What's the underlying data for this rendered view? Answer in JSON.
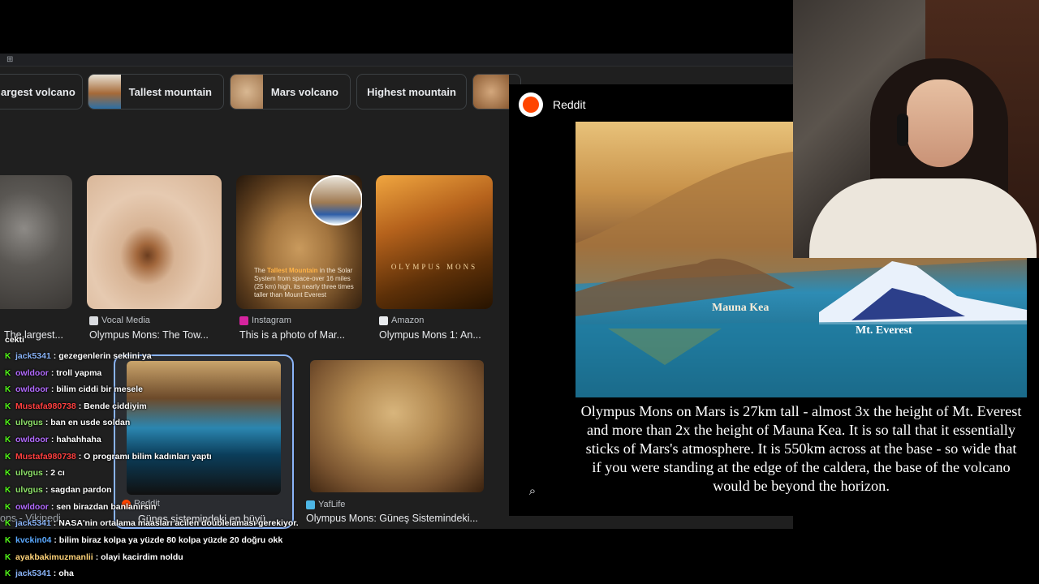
{
  "browser": {
    "apps_icon": "apps-grid-icon"
  },
  "chips": [
    {
      "label": "argest volcano",
      "thumb": false
    },
    {
      "label": "Tallest mountain",
      "thumb": true
    },
    {
      "label": "Mars volcano",
      "thumb": true
    },
    {
      "label": "Highest mountain",
      "thumb": false
    },
    {
      "label": "",
      "thumb": true
    }
  ],
  "results": [
    {
      "source": "",
      "title": "The largest..."
    },
    {
      "source": "Vocal Media",
      "title": "Olympus Mons: The Tow..."
    },
    {
      "source": "Instagram",
      "title": "This is a photo of Mar..."
    },
    {
      "source": "Amazon",
      "title": "Olympus Mons 1: An..."
    },
    {
      "source": "Reddit",
      "title": "Güneş sistemindeki en büyü..."
    },
    {
      "source": "YafLife",
      "title": "Olympus Mons: Güneş Sistemindeki..."
    },
    {
      "source": "",
      "title": "ons - Vikipedi"
    }
  ],
  "tile_texts": {
    "instagram_caption_pre": "The",
    "instagram_caption_hl": "Tallest Mountain",
    "instagram_caption_post": "in the Solar System from space-over 16 miles (25 km) high, its nearly three times taller than Mount Everest",
    "amazon_cover": "OLYMPUS MONS"
  },
  "panel": {
    "site": "Reddit",
    "label_mauna_kea": "Mauna Kea",
    "label_everest": "Mt. Everest",
    "caption": "Olympus Mons on Mars is 27km tall - almost 3x the height of Mt. Everest and more than 2x the height of Mauna Kea. It is so tall that it essentially sticks of Mars's atmosphere. It is 550km across at the base - so wide that if you were standing at the edge of the caldera, the base of the volcano would be beyond the horizon."
  },
  "chat": [
    {
      "user": "",
      "msg": "cekti",
      "color": "#ffffff",
      "badge": false
    },
    {
      "user": "jack5341",
      "msg": ": gezegenlerin seklini ya",
      "color": "#8ab4f8",
      "badge": true
    },
    {
      "user": "owldoor",
      "msg": ": troll yapma",
      "color": "#b36bff",
      "badge": true
    },
    {
      "user": "owldoor",
      "msg": ": bilim ciddi bir mesele",
      "color": "#b36bff",
      "badge": true
    },
    {
      "user": "Mustafa980738",
      "msg": ": Bende ciddiyim",
      "color": "#ff4040",
      "badge": true
    },
    {
      "user": "ulvgus",
      "msg": ": ban en usde soldan",
      "color": "#8fe36a",
      "badge": true
    },
    {
      "user": "owldoor",
      "msg": ": hahahhaha",
      "color": "#b36bff",
      "badge": true
    },
    {
      "user": "Mustafa980738",
      "msg": ": O programı bilim kadınları yaptı",
      "color": "#ff4040",
      "badge": true
    },
    {
      "user": "ulvgus",
      "msg": ": 2 cı",
      "color": "#8fe36a",
      "badge": true
    },
    {
      "user": "ulvgus",
      "msg": ": sagdan pardon",
      "color": "#8fe36a",
      "badge": true
    },
    {
      "user": "owldoor",
      "msg": ": sen birazdan banlanırsın",
      "color": "#b36bff",
      "badge": true
    },
    {
      "user": "jack5341",
      "msg": ": NASA'nin ortalama maasları acilen doublelaması gerekiyor.",
      "color": "#8ab4f8",
      "badge": true
    },
    {
      "user": "kvckin04",
      "msg": ": bilim biraz kolpa ya yüzde 80 kolpa yüzde 20 doğru okk",
      "color": "#5aa9ff",
      "badge": true
    },
    {
      "user": "ayakbakimuzmanlii",
      "msg": ": olayi kacirdim noldu",
      "color": "#ffd479",
      "badge": true
    },
    {
      "user": "jack5341",
      "msg": ": oha",
      "color": "#8ab4f8",
      "badge": true
    }
  ]
}
